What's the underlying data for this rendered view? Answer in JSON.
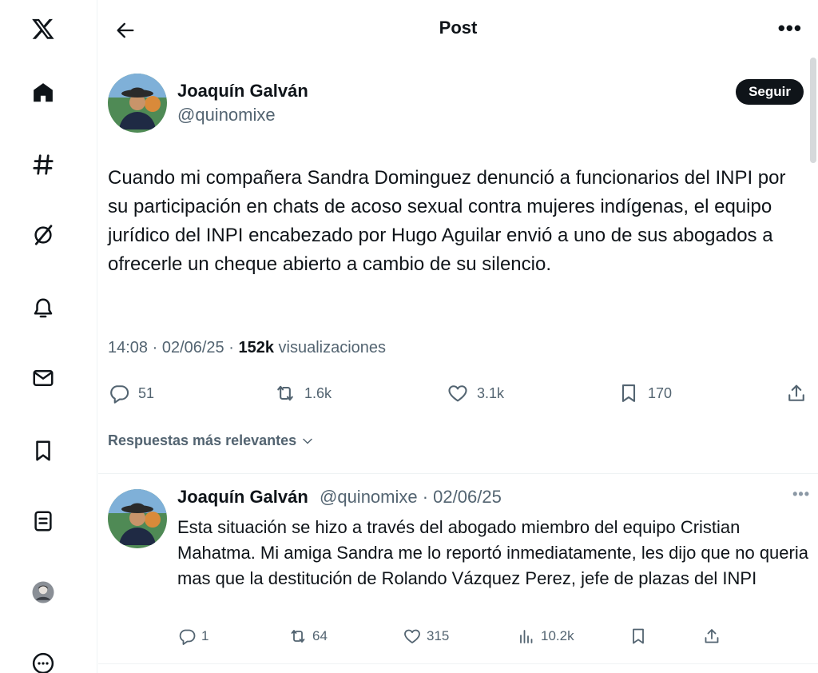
{
  "nav": {
    "items": [
      {
        "name": "x-logo-icon"
      },
      {
        "name": "home-icon"
      },
      {
        "name": "explore-icon"
      },
      {
        "name": "grok-icon"
      },
      {
        "name": "notifications-icon"
      },
      {
        "name": "messages-icon"
      },
      {
        "name": "bookmarks-icon"
      },
      {
        "name": "lists-icon"
      },
      {
        "name": "profile-avatar"
      },
      {
        "name": "more-options-icon"
      }
    ]
  },
  "header": {
    "title": "Post",
    "more_label": "•••"
  },
  "post": {
    "author": {
      "name": "Joaquín Galván",
      "handle": "@quinomixe"
    },
    "follow_label": "Seguir",
    "text": "Cuando mi compañera Sandra Dominguez denunció a funcionarios del INPI por su participación en chats de acoso sexual contra mujeres indígenas, el equipo jurídico del INPI encabezado por Hugo Aguilar envió a uno de sus abogados a ofrecerle un cheque abierto a cambio de su silencio.",
    "time": "14:08 · 02/06/25 · ",
    "views_count": "152k",
    "views_label": " visualizaciones",
    "replies": "51",
    "reposts": "1.6k",
    "likes": "3.1k",
    "bookmarks": "170"
  },
  "sort_label": "Respuestas más relevantes",
  "reply": {
    "author_name": "Joaquín Galván",
    "meta": "@quinomixe · 02/06/25",
    "more_label": "•••",
    "text": "Esta situación se hizo a través del abogado miembro del equipo Cristian Mahatma. Mi amiga Sandra me lo reportó inmediatamente, les dijo que no queria mas que la destitución de Rolando Vázquez Perez, jefe de plazas del INPI",
    "replies": "1",
    "reposts": "64",
    "likes": "315",
    "views": "10.2k"
  }
}
